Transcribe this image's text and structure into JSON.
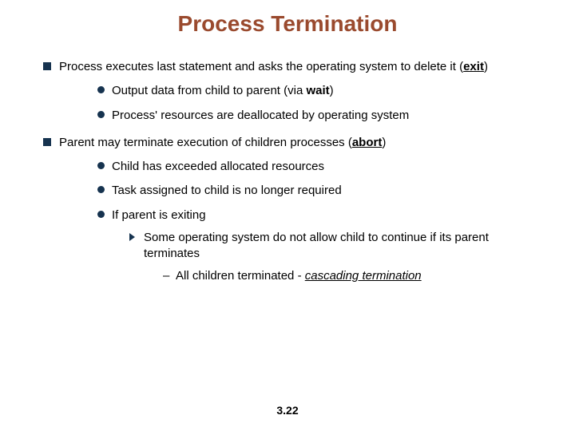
{
  "title": "Process Termination",
  "bullets": {
    "b1_pre": "Process executes last statement and asks the operating system to delete it (",
    "b1_kw": "exit",
    "b1_post": ")",
    "b1_1_pre": "Output data from child to parent (via ",
    "b1_1_kw": "wait",
    "b1_1_post": ")",
    "b1_2": "Process' resources are deallocated by operating system",
    "b2_pre": "Parent may terminate execution of children processes (",
    "b2_kw": "abort",
    "b2_post": ")",
    "b2_1": "Child has exceeded allocated resources",
    "b2_2": "Task assigned to child is no longer required",
    "b2_3": "If parent is exiting",
    "b2_3_1": "Some operating system do not allow child to continue if its parent terminates",
    "b2_3_1_1_pre": "All children terminated - ",
    "b2_3_1_1_kw": "cascading termination"
  },
  "footer": "3.22",
  "dash": "–"
}
